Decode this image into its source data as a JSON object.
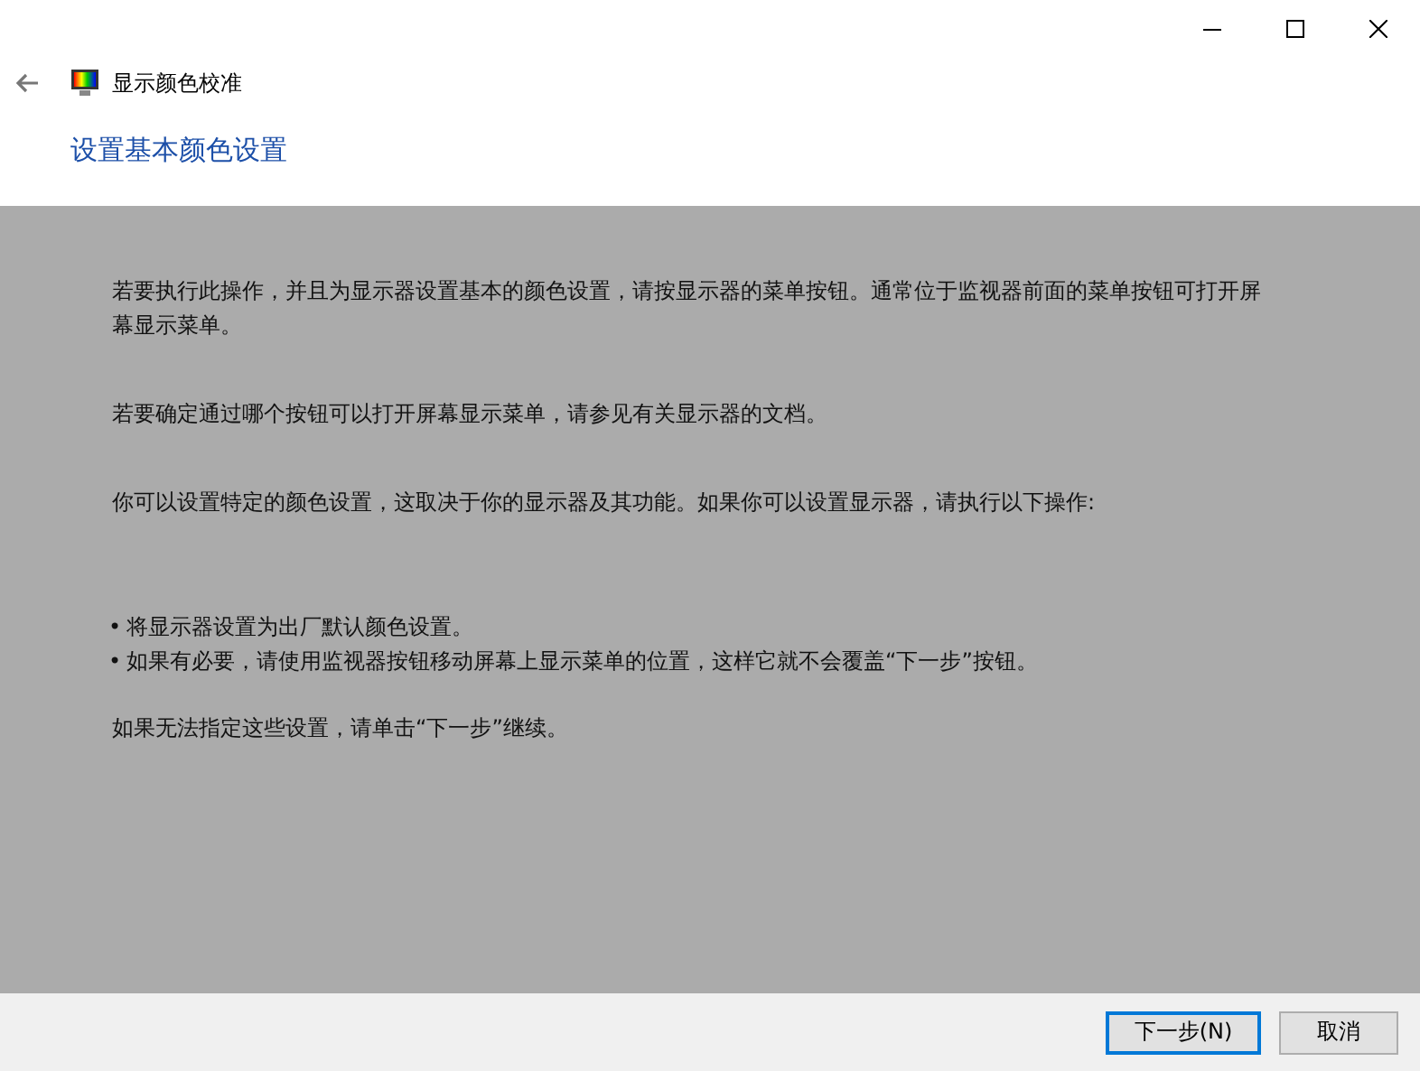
{
  "window": {
    "title": "显示颜色校准",
    "controls": [
      {
        "kind": "minimize"
      },
      {
        "kind": "maximize"
      },
      {
        "kind": "close"
      }
    ]
  },
  "heading": "设置基本颜色设置",
  "paragraphs": [
    {
      "kind": "text",
      "text": "若要执行此操作，并且为显示器设置基本的颜色设置，请按显示器的菜单按钮。通常位于监视器前面的菜单按钮可打开屏幕显示菜单。"
    },
    {
      "kind": "text",
      "text": "若要确定通过哪个按钮可以打开屏幕显示菜单，请参见有关显示器的文档。"
    },
    {
      "kind": "text",
      "text": "你可以设置特定的颜色设置，这取决于你的显示器及其功能。如果你可以设置显示器，请执行以下操作:"
    },
    {
      "kind": "bullets",
      "bullet": "•",
      "items": [
        "将显示器设置为出厂默认颜色设置。",
        "如果有必要，请使用监视器按钮移动屏幕上显示菜单的位置，这样它就不会覆盖“下一步”按钮。"
      ]
    },
    {
      "kind": "text",
      "text": "如果无法指定这些设置，请单击“下一步”继续。"
    }
  ],
  "buttons": [
    {
      "label": "下一步(N)",
      "focused": true
    },
    {
      "label": "取消",
      "focused": false
    }
  ]
}
